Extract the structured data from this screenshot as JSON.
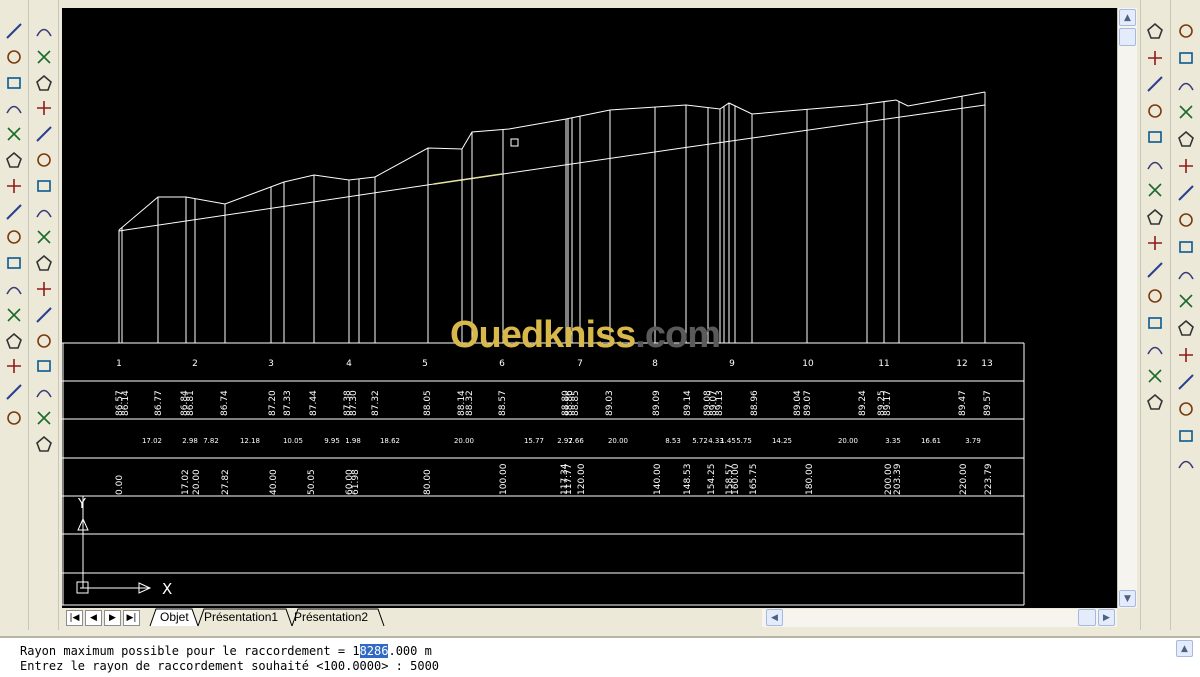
{
  "drawing": {
    "station_labels": [
      "1",
      "2",
      "3",
      "4",
      "5",
      "6",
      "7",
      "8",
      "9",
      "10",
      "11",
      "12",
      "13"
    ],
    "elevations": [
      "86.57",
      "86.14",
      "86.77",
      "86.84",
      "86.81",
      "86.74",
      "87.20",
      "87.33",
      "87.44",
      "87.38",
      "87.30",
      "87.32",
      "88.05",
      "88.14",
      "88.32",
      "88.57",
      "88.80",
      "88.86",
      "88.85",
      "89.03",
      "89.09",
      "89.14",
      "89.08",
      "89.07",
      "89.13",
      "88.96",
      "89.04",
      "89.07",
      "89.24",
      "89.25",
      "89.17",
      "89.47",
      "89.57"
    ],
    "partial_distances": [
      "17.02",
      "2.98",
      "7.82",
      "12.18",
      "10.05",
      "9.95",
      "1.98",
      "18.62",
      "20.00",
      "15.77",
      "2.97",
      "2.66",
      "20.00",
      "8.53",
      "5.72",
      "4.33",
      "1.45",
      "5.75",
      "14.25",
      "20.00",
      "3.35",
      "16.61",
      "3.79"
    ],
    "cumulative_distances": [
      "0.00",
      "17.02",
      "20.00",
      "27.82",
      "40.00",
      "50.05",
      "60.00",
      "61.98",
      "80.00",
      "100.00",
      "117.34",
      "117.77",
      "120.00",
      "140.00",
      "148.53",
      "154.25",
      "158.57",
      "160.00",
      "165.75",
      "180.00",
      "200.00",
      "203.39",
      "220.00",
      "223.79"
    ],
    "ucs_x_label": "X",
    "ucs_y_label": "Y",
    "watermark": {
      "part1": "Oued",
      "part2": "kniss",
      "part3": ".com"
    },
    "colors": {
      "background": "#000000",
      "lines": "#ffffff",
      "watermark_yellow": "#d8b84a",
      "watermark_grey": "#5a5a5a"
    }
  },
  "tabs": {
    "nav": [
      "|◀",
      "◀",
      "▶",
      "▶|"
    ],
    "items": [
      "Objet",
      "Présentation1",
      "Présentation2"
    ],
    "active": "Objet"
  },
  "command_line": {
    "line1_prefix": "Rayon maximum possible pour le raccordement = 1",
    "line1_highlight": "8286",
    "line1_suffix": ".000 m",
    "line2": "Entrez le rayon de raccordement souhaité <100.0000> : 5000"
  },
  "toolbars": {
    "modify": [
      "erase-icon",
      "copy-icon",
      "mirror-icon",
      "offset-icon",
      "array-icon",
      "move-icon",
      "rotate-icon",
      "scale-icon",
      "stretch-icon",
      "trim-icon",
      "extend-icon",
      "break-icon",
      "join-icon",
      "chamfer-icon",
      "fillet-icon",
      "explode-icon"
    ],
    "draw": [
      "line-icon",
      "construction-line-icon",
      "polyline-icon",
      "polygon-icon",
      "rectangle-icon",
      "arc-icon",
      "circle-icon",
      "revision-cloud-icon",
      "spline-icon",
      "ellipse-icon",
      "ellipse-arc-icon",
      "insert-block-icon",
      "make-block-icon",
      "point-icon",
      "hatch-icon",
      "region-icon",
      "text-icon"
    ],
    "dimension": [
      "linear-dim-icon",
      "aligned-dim-icon",
      "ordinate-dim-icon",
      "radius-dim-icon",
      "diameter-dim-icon",
      "angular-dim-icon",
      "quick-dim-icon",
      "baseline-dim-icon",
      "continue-dim-icon",
      "leader-icon",
      "tolerance-icon",
      "center-mark-icon",
      "dim-edit-icon",
      "dim-text-edit-icon",
      "dim-update-icon"
    ],
    "osnap": [
      "temp-track-icon",
      "snap-from-icon",
      "snap-endpoint-icon",
      "snap-midpoint-icon",
      "snap-intersection-icon",
      "snap-apparent-icon",
      "snap-extension-icon",
      "snap-center-icon",
      "snap-quadrant-icon",
      "snap-tangent-icon",
      "snap-perpendicular-icon",
      "snap-parallel-icon",
      "snap-insert-icon",
      "snap-node-icon",
      "snap-nearest-icon",
      "snap-none-icon",
      "osnap-settings-icon"
    ]
  }
}
